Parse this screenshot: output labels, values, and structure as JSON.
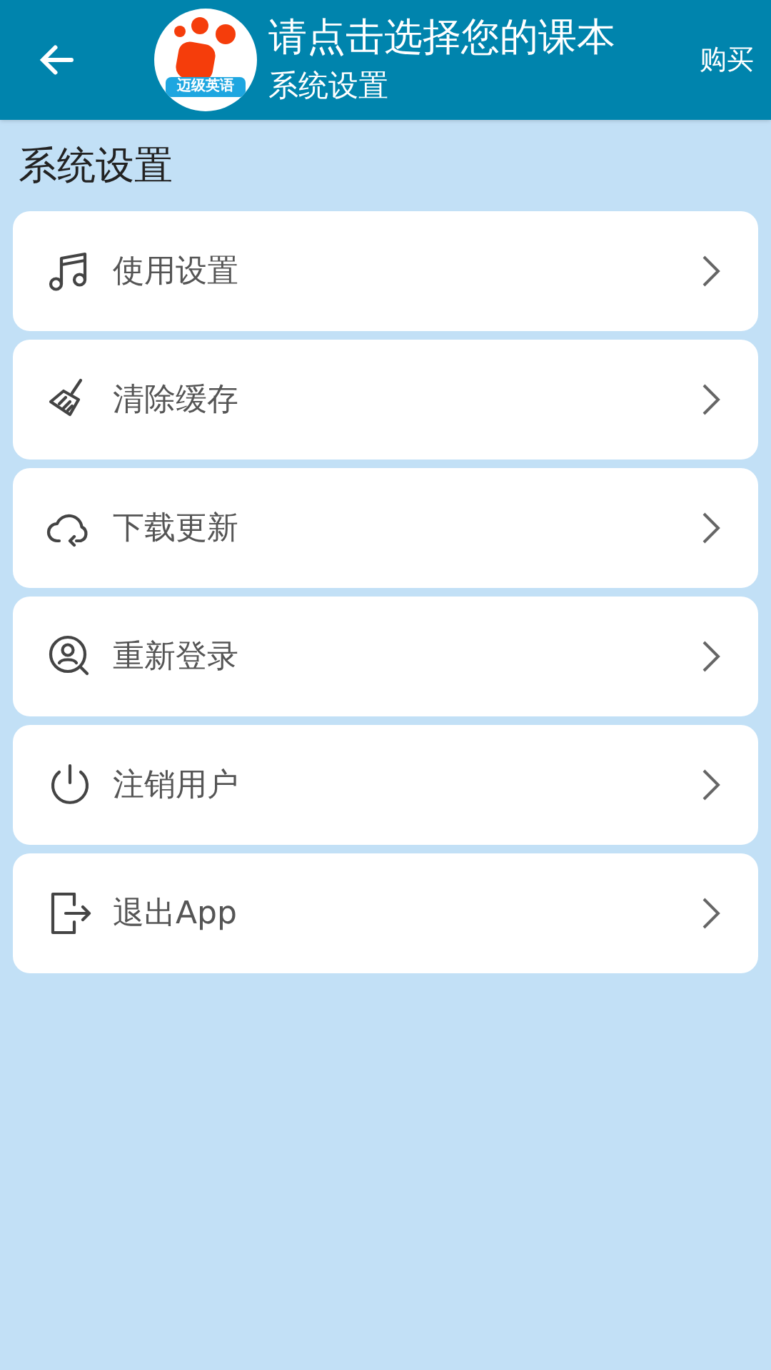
{
  "header": {
    "title": "请点击选择您的课本",
    "subtitle": "系统设置",
    "logo_text": "迈级英语",
    "action": "购买"
  },
  "section_title": "系统设置",
  "items": [
    {
      "kind": "music",
      "label": "使用设置"
    },
    {
      "kind": "broom",
      "label": "清除缓存"
    },
    {
      "kind": "cloud",
      "label": "下载更新"
    },
    {
      "kind": "user",
      "label": "重新登录"
    },
    {
      "kind": "power",
      "label": "注销用户"
    },
    {
      "kind": "exit",
      "label": "退出App"
    }
  ]
}
